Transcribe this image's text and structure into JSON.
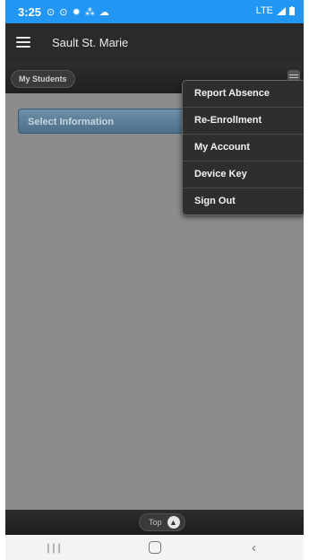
{
  "status_bar": {
    "time": "3:25",
    "icons_left": "⊙ ⊙ ✹ ⁂ ☁",
    "signal": "LTE",
    "battery_icon": "battery-icon"
  },
  "header": {
    "title": "Sault St. Marie",
    "menu_icon": "hamburger-icon"
  },
  "subbar": {
    "my_students_label": "My Students"
  },
  "main": {
    "select_info_label": "Select Information"
  },
  "dropdown": {
    "items": [
      {
        "label": "Report Absence"
      },
      {
        "label": "Re-Enrollment"
      },
      {
        "label": "My Account"
      },
      {
        "label": "Device Key"
      },
      {
        "label": "Sign Out"
      }
    ]
  },
  "footer": {
    "top_label": "Top"
  },
  "colors": {
    "status_bar": "#2196F3",
    "header": "#2a2a2a",
    "content_bg": "#8c8c8c",
    "select_button": "#5e7f98"
  }
}
